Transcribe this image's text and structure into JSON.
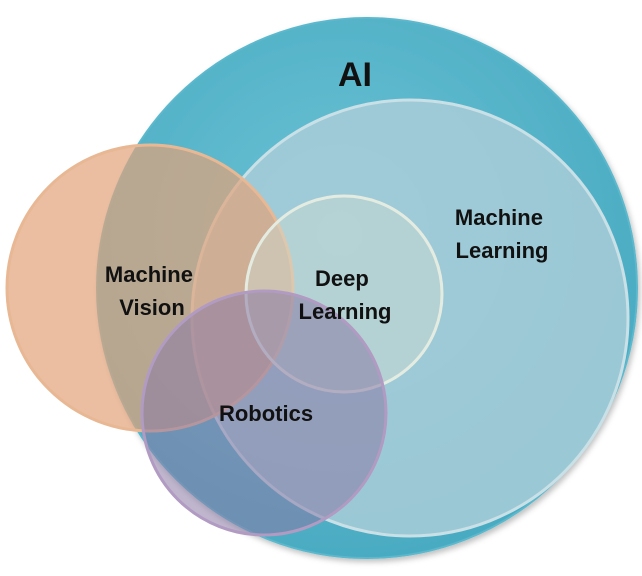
{
  "diagram": {
    "sets": [
      {
        "id": "ai",
        "label_lines": [
          "AI"
        ],
        "color": "#4fb3c9"
      },
      {
        "id": "machine-learning",
        "label_lines": [
          "Machine",
          "Learning"
        ],
        "color": "#a9cdd8"
      },
      {
        "id": "machine-vision",
        "label_lines": [
          "Machine",
          "Vision"
        ],
        "color": "#e3a379"
      },
      {
        "id": "deep-learning",
        "label_lines": [
          "Deep",
          "Learning"
        ],
        "color": "#cfdcd0"
      },
      {
        "id": "robotics",
        "label_lines": [
          "Robotics"
        ],
        "color": "#8a7aa6"
      }
    ]
  }
}
